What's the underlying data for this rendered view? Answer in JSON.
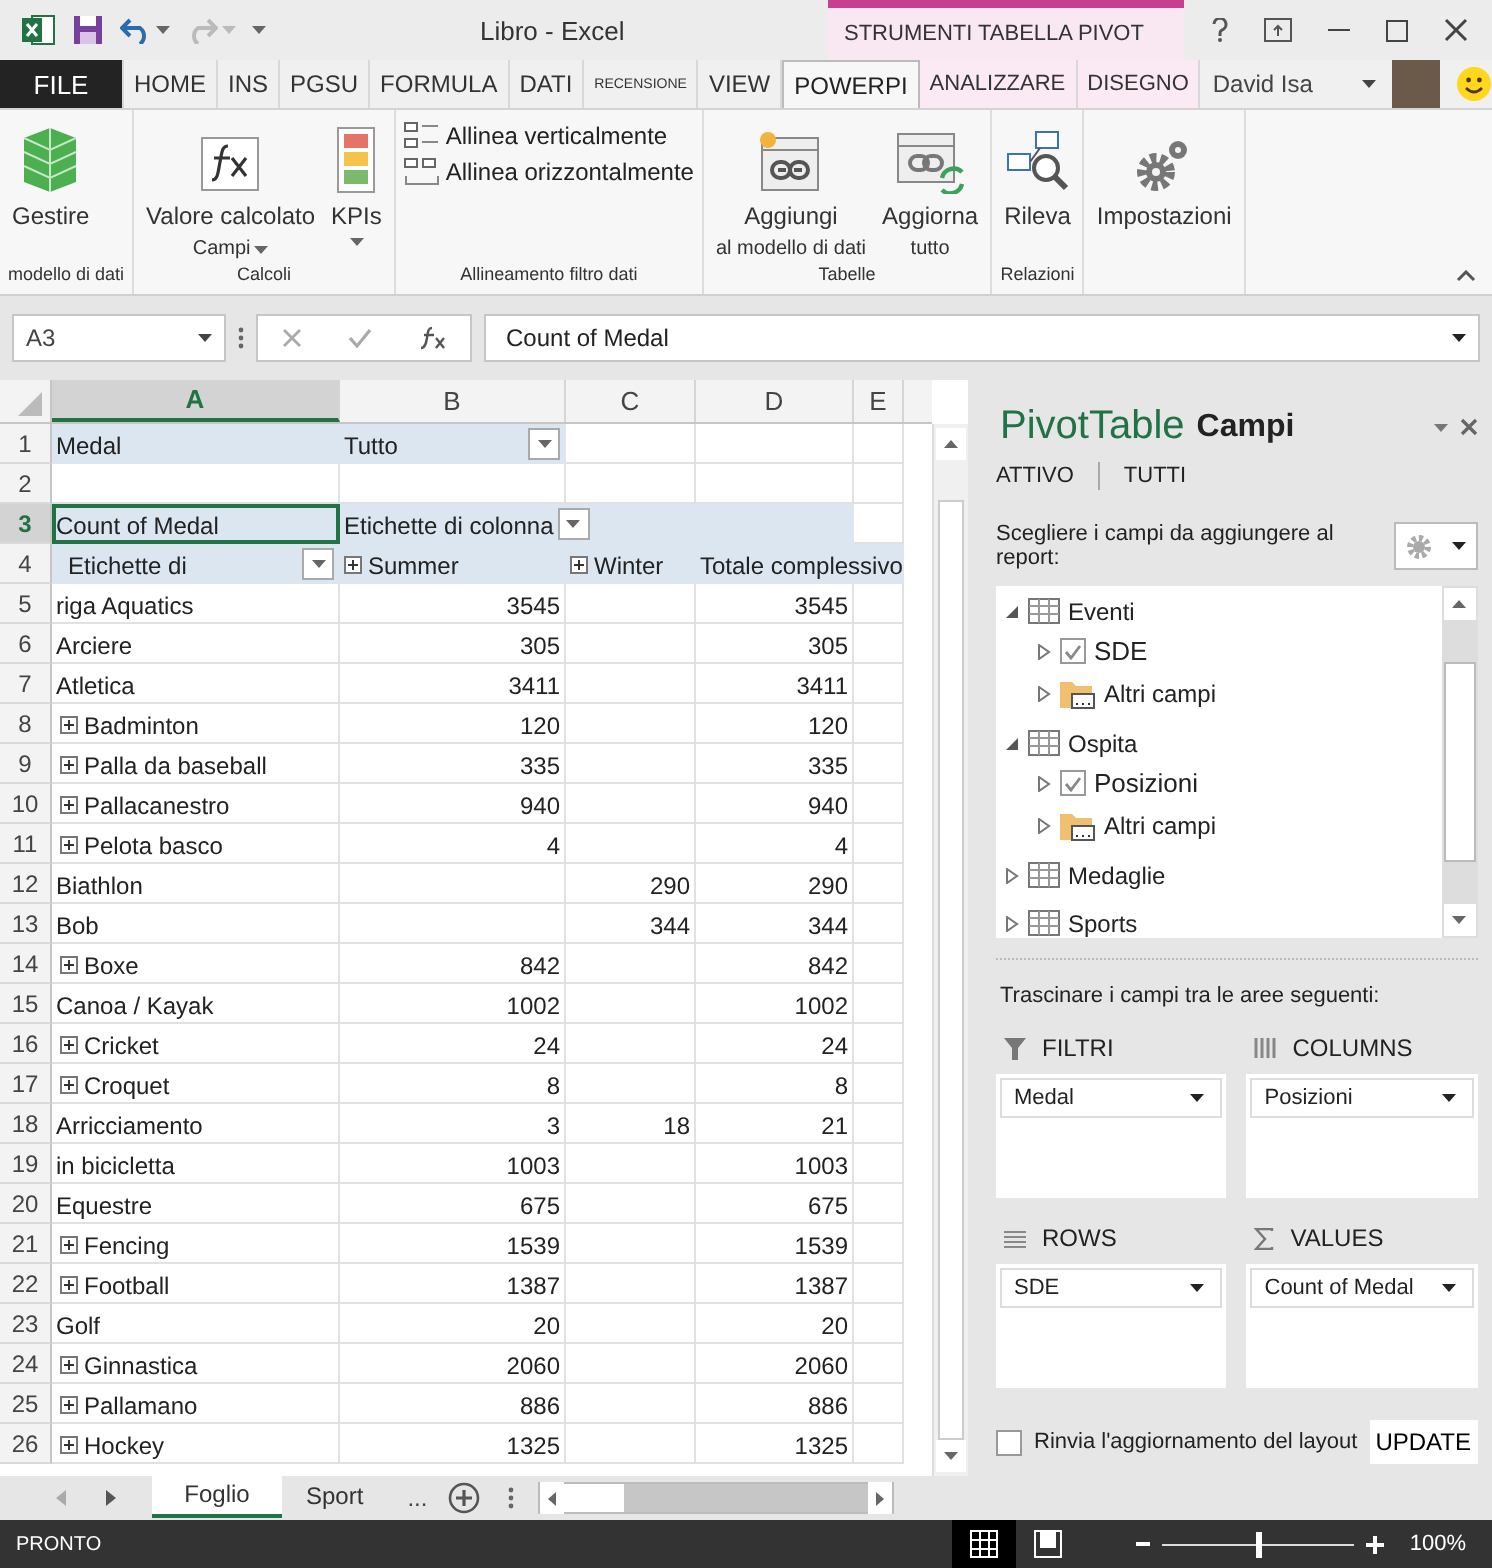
{
  "window": {
    "title": "Libro - Excel",
    "contextual_title": "STRUMENTI TABELLA PIVOT"
  },
  "tabs": [
    {
      "label": "FILE",
      "kind": "file",
      "selected": false
    },
    {
      "label": "HOME",
      "kind": "normal",
      "selected": false
    },
    {
      "label": "INS",
      "kind": "normal",
      "selected": false
    },
    {
      "label": "PGSU",
      "kind": "normal",
      "selected": false
    },
    {
      "label": "FORMULA",
      "kind": "normal",
      "selected": false
    },
    {
      "label": "DATI",
      "kind": "normal",
      "selected": false
    },
    {
      "label": "RECENSIONE",
      "kind": "small",
      "selected": false
    },
    {
      "label": "VIEW",
      "kind": "normal",
      "selected": false
    },
    {
      "label": "POWERPI",
      "kind": "normal",
      "selected": true
    },
    {
      "label": "ANALIZZARE",
      "kind": "contextual",
      "selected": false
    },
    {
      "label": "DISEGNO",
      "kind": "contextual",
      "selected": false
    }
  ],
  "user": {
    "name": "David Isa"
  },
  "ribbon": {
    "groups": [
      {
        "label": "modello di dati",
        "commands": [
          {
            "kind": "large",
            "lines": [
              "Gestire"
            ],
            "dropdown": false
          }
        ]
      },
      {
        "label": "Calcoli",
        "commands": [
          {
            "kind": "large",
            "lines": [
              "Valore calcolato",
              "Campi"
            ],
            "dropdown": true
          },
          {
            "kind": "large",
            "lines": [
              "KPIs"
            ],
            "dropdown": true
          }
        ]
      },
      {
        "label": "Allineamento filtro dati",
        "commands": [
          {
            "kind": "small",
            "lines": [
              "Allinea verticalmente"
            ],
            "dropdown": false
          },
          {
            "kind": "small",
            "lines": [
              "Allinea orizzontalmente"
            ],
            "dropdown": false
          }
        ]
      },
      {
        "label": "Tabelle",
        "commands": [
          {
            "kind": "large",
            "lines": [
              "Aggiungi",
              "al modello di dati"
            ],
            "dropdown": false
          },
          {
            "kind": "large",
            "lines": [
              "Aggiorna",
              "tutto"
            ],
            "dropdown": false
          }
        ]
      },
      {
        "label": "Relazioni",
        "commands": [
          {
            "kind": "large",
            "lines": [
              "Rileva"
            ],
            "dropdown": false
          }
        ]
      },
      {
        "commands": [
          {
            "kind": "large",
            "lines": [
              "Impostazioni"
            ],
            "dropdown": false
          }
        ]
      }
    ]
  },
  "formula_bar": {
    "name_box": "A3",
    "formula": "Count of Medal"
  },
  "grid": {
    "columns": [
      {
        "label": "A",
        "selected": true
      },
      {
        "label": "B",
        "selected": false
      },
      {
        "label": "C",
        "selected": false
      },
      {
        "label": "D",
        "selected": false
      },
      {
        "label": "E",
        "selected": false
      }
    ],
    "rows": [
      {
        "number": "1",
        "kind": "filter",
        "selected": false,
        "label": "Medal",
        "value": "Tutto"
      },
      {
        "number": "2",
        "kind": "blank",
        "selected": false
      },
      {
        "number": "3",
        "kind": "values_header",
        "selected": true,
        "label": "Count of Medal",
        "value": "Etichette di colonna"
      },
      {
        "number": "4",
        "kind": "column_header",
        "selected": false,
        "label": "Etichette di",
        "columns": [
          {
            "label": "Summer",
            "expandable": true
          },
          {
            "label": "Winter",
            "expandable": true
          },
          {
            "label": "Totale complessivo",
            "expandable": false
          }
        ]
      },
      {
        "number": "5",
        "kind": "data",
        "selected": false,
        "label": "riga Aquatics",
        "expandable": false,
        "summer": "3545",
        "total": "3545"
      },
      {
        "number": "6",
        "kind": "data",
        "selected": false,
        "label": "Arciere",
        "expandable": false,
        "summer": "305",
        "total": "305"
      },
      {
        "number": "7",
        "kind": "data",
        "selected": false,
        "label": "Atletica",
        "expandable": false,
        "summer": "3411",
        "total": "3411"
      },
      {
        "number": "8",
        "kind": "data",
        "selected": false,
        "label": "Badminton",
        "expandable": true,
        "summer": "120",
        "total": "120"
      },
      {
        "number": "9",
        "kind": "data",
        "selected": false,
        "label": "Palla da baseball",
        "expandable": true,
        "summer": "335",
        "total": "335"
      },
      {
        "number": "10",
        "kind": "data",
        "selected": false,
        "label": "Pallacanestro",
        "expandable": true,
        "summer": "940",
        "total": "940"
      },
      {
        "number": "11",
        "kind": "data",
        "selected": false,
        "label": "Pelota basco",
        "expandable": true,
        "summer": "4",
        "total": "4"
      },
      {
        "number": "12",
        "kind": "data",
        "selected": false,
        "label": "Biathlon",
        "expandable": false,
        "winter": "290",
        "total": "290"
      },
      {
        "number": "13",
        "kind": "data",
        "selected": false,
        "label": "Bob",
        "expandable": false,
        "winter": "344",
        "total": "344"
      },
      {
        "number": "14",
        "kind": "data",
        "selected": false,
        "label": "Boxe",
        "expandable": true,
        "summer": "842",
        "total": "842"
      },
      {
        "number": "15",
        "kind": "data",
        "selected": false,
        "label": "Canoa / Kayak",
        "expandable": false,
        "summer": "1002",
        "total": "1002"
      },
      {
        "number": "16",
        "kind": "data",
        "selected": false,
        "label": "Cricket",
        "expandable": true,
        "summer": "24",
        "total": "24"
      },
      {
        "number": "17",
        "kind": "data",
        "selected": false,
        "label": "Croquet",
        "expandable": true,
        "summer": "8",
        "total": "8"
      },
      {
        "number": "18",
        "kind": "data",
        "selected": false,
        "label": "Arricciamento",
        "expandable": false,
        "summer": "3",
        "winter": "18",
        "total": "21"
      },
      {
        "number": "19",
        "kind": "data",
        "selected": false,
        "label": "in bicicletta",
        "expandable": false,
        "summer": "1003",
        "total": "1003"
      },
      {
        "number": "20",
        "kind": "data",
        "selected": false,
        "label": "Equestre",
        "expandable": false,
        "summer": "675",
        "total": "675"
      },
      {
        "number": "21",
        "kind": "data",
        "selected": false,
        "label": "Fencing",
        "expandable": true,
        "summer": "1539",
        "total": "1539"
      },
      {
        "number": "22",
        "kind": "data",
        "selected": false,
        "label": "Football",
        "expandable": true,
        "summer": "1387",
        "total": "1387"
      },
      {
        "number": "23",
        "kind": "data",
        "selected": false,
        "label": "Golf",
        "expandable": false,
        "summer": "20",
        "total": "20"
      },
      {
        "number": "24",
        "kind": "data",
        "selected": false,
        "label": "Ginnastica",
        "expandable": true,
        "summer": "2060",
        "total": "2060"
      },
      {
        "number": "25",
        "kind": "data",
        "selected": false,
        "label": "Pallamano",
        "expandable": true,
        "summer": "886",
        "total": "886"
      },
      {
        "number": "26",
        "kind": "data",
        "selected": false,
        "label": "Hockey",
        "expandable": true,
        "summer": "1325",
        "total": "1325"
      }
    ]
  },
  "sheet_tabs": {
    "tabs": [
      {
        "label": "Foglio",
        "selected": true
      },
      {
        "label": "Sport",
        "selected": false
      }
    ],
    "overflow": "..."
  },
  "field_list": {
    "title": "PivotTable",
    "subtitle": "Campi",
    "views": [
      "ATTIVO",
      "TUTTI"
    ],
    "prompt": "Scegliere i campi da aggiungere al report:",
    "tables": [
      {
        "name": "Eventi",
        "expanded": true,
        "children": [
          {
            "name": "SDE",
            "kind": "field",
            "checked": true
          },
          {
            "name": "Altri campi",
            "kind": "folder"
          }
        ]
      },
      {
        "name": "Ospita",
        "expanded": true,
        "children": [
          {
            "name": "Posizioni",
            "kind": "field",
            "checked": true
          },
          {
            "name": "Altri campi",
            "kind": "folder"
          }
        ]
      },
      {
        "name": "Medaglie",
        "expanded": false
      },
      {
        "name": "Sports",
        "expanded": false
      }
    ],
    "areas_prompt": "Trascinare i campi tra le aree seguenti:",
    "areas": [
      {
        "kind": "filters",
        "label": "FILTRI",
        "fields": [
          "Medal"
        ]
      },
      {
        "kind": "columns",
        "label": "COLUMNS",
        "fields": [
          "Posizioni"
        ]
      },
      {
        "kind": "rows",
        "label": "ROWS",
        "fields": [
          "SDE"
        ]
      },
      {
        "kind": "values",
        "label": "VALUES",
        "fields": [
          "Count of Medal"
        ]
      }
    ],
    "defer": {
      "label": "Rinvia l'aggiornamento del layout",
      "checked": false
    },
    "update_button": "UPDATE"
  },
  "status_bar": {
    "text": "PRONTO",
    "views": [
      {
        "kind": "normal",
        "selected": true
      },
      {
        "kind": "page_layout",
        "selected": false
      }
    ],
    "zoom": {
      "level": 0.5,
      "reading": "100%"
    }
  }
}
